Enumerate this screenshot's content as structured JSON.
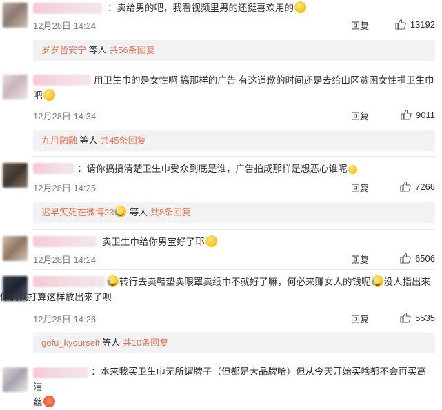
{
  "comments": [
    {
      "text": "：卖给男的吧，我看视频里男的还挺喜欢用的",
      "time": "12月28日 14:24",
      "reply_label": "回复",
      "likes": "13192",
      "replies": {
        "name": "岁岁皆安宁",
        "mid": " 等人 ",
        "count": "共56条回复"
      }
    },
    {
      "text_line1": "用卫生巾的是女性啊 搞那样的广告 有这道歉的时间还是去给山区贫困女性捐卫生巾",
      "text_line2": "吧",
      "time": "12月28日 14:34",
      "reply_label": "回复",
      "likes": "9011",
      "replies": {
        "name": "九月融融",
        "mid": " 等人 ",
        "count": "共45条回复"
      }
    },
    {
      "text": "：请你搞搞清楚卫生巾受众到底是谁，广告拍成那样是想恶心谁呢",
      "time": "12月28日 14:25",
      "reply_label": "回复",
      "likes": "7266",
      "replies": {
        "name": "迟早笑死在微博23",
        "mid": " 等人 ",
        "count": "共8条回复"
      }
    },
    {
      "text": "卖卫生巾给你男宝好了耶",
      "time": "12月28日 14:24",
      "reply_label": "回复",
      "likes": "6506"
    },
    {
      "text_a": "转行去卖鞋垫卖眼罩卖纸巾不就好了嘛，何必来赚女人的钱呢",
      "text_b": "没人指出来",
      "text_line2": "你们就打算这样放出来了呗",
      "time": "12月28日 14:26",
      "reply_label": "回复",
      "likes": "5535",
      "replies": {
        "name": "gofu_kyourself",
        "mid": " 等人 ",
        "count": "共10条回复"
      }
    },
    {
      "text_line1": "：本来我买卫生巾无所谓牌子（但都是大品牌哈）但从今天开始买啥都不会再买高洁",
      "text_line2": "丝"
    }
  ],
  "icons": {
    "like": "thumbs-up-icon",
    "emoji": "emoji-face-icon"
  }
}
